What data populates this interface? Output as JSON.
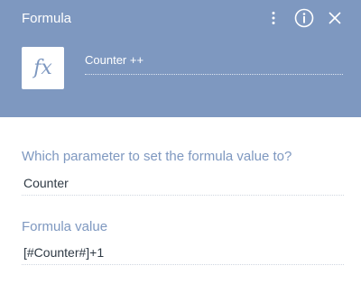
{
  "header": {
    "title": "Formula",
    "icon_names": [
      "more-vertical-icon",
      "info-icon",
      "close-icon"
    ],
    "element_icon": "fx-icon",
    "element_icon_text": "fx",
    "element_name": "Counter ++"
  },
  "fields": {
    "parameter": {
      "label": "Which parameter to set the formula value to?",
      "value": "Counter"
    },
    "formula": {
      "label": "Formula value",
      "value": "[#Counter#]+1"
    }
  },
  "colors": {
    "header_bg": "#7e98c0",
    "label_text": "#7e98c0",
    "value_text": "#2f3a45",
    "white": "#ffffff"
  }
}
